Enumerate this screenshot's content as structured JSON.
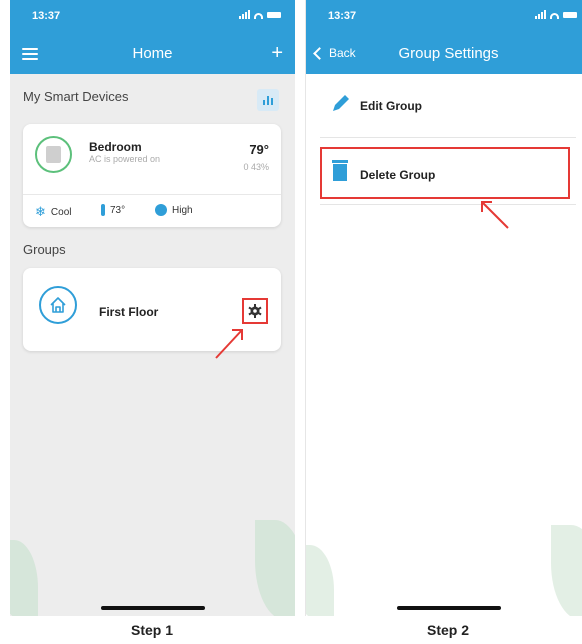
{
  "step1": {
    "status_time": "13:37",
    "header": {
      "title": "Home",
      "plus": "+"
    },
    "my_devices_label": "My Smart Devices",
    "device": {
      "name": "Bedroom",
      "status": "AC is powered on",
      "temp": "79°",
      "humidity": "0 43%",
      "mode": "Cool",
      "set_temp": "73°",
      "fan": "High"
    },
    "groups_label": "Groups",
    "group": {
      "name": "First Floor"
    },
    "caption": "Step 1"
  },
  "step2": {
    "status_time": "13:37",
    "header": {
      "back_label": "Back",
      "title": "Group Settings"
    },
    "edit_label": "Edit Group",
    "delete_label": "Delete Group",
    "caption": "Step 2"
  },
  "colors": {
    "primary": "#2f9ed8",
    "highlight": "#e53935",
    "accent_green": "#5cc07b"
  }
}
